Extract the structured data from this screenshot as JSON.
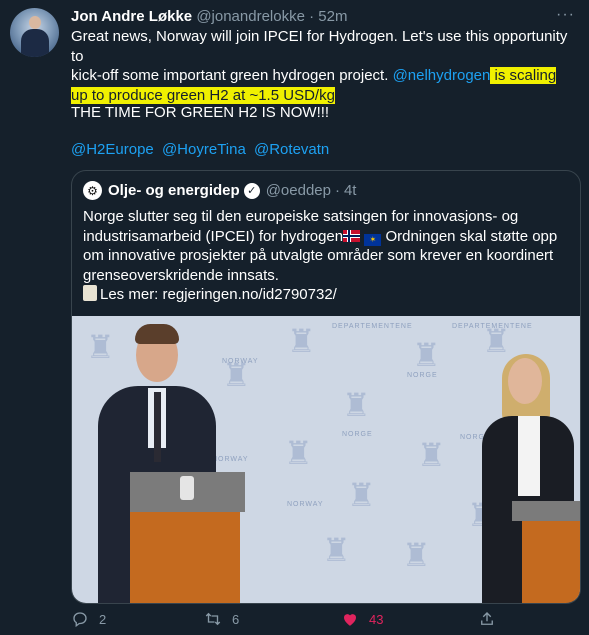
{
  "tweet": {
    "author_name": "Jon Andre Løkke",
    "author_handle": "@jonandrelokke",
    "separator": "·",
    "time": "52m",
    "more_label": "···",
    "line1": "Great news, Norway will join IPCEI for Hydrogen. Let's use this opportunity to",
    "line2_prefix": "kick-off some important green hydrogen project. ",
    "line2_mention": "@nelhydrogen",
    "line2_highlight": " is scaling",
    "line3_highlight": "up to produce green H2 at ~1.5 USD/kg",
    "shout": "THE TIME FOR GREEN H2 IS NOW!!!",
    "hashtags": [
      "@H2Europe",
      "@HoyreTina",
      "@Rotevatn"
    ]
  },
  "quote": {
    "author_name": "Olje- og energidep",
    "author_handle": "@oeddep",
    "separator": "·",
    "time": "4t",
    "verified_icon": "✓",
    "text_line1": "Norge slutter seg til den europeiske satsingen for innovasjons- og",
    "text_line2_a": "industrisamarbeid (IPCEI) for hydrogen",
    "text_line2_b": " Ordningen skal støtte opp",
    "text_line3": "om innovative prosjekter på utvalgte områder som krever en koordinert",
    "text_line4": "grenseoverskridende innsats.",
    "text_line5": "Les mer: regjeringen.no/id2790732/",
    "eu_stars": "✶"
  },
  "photo": {
    "backdrop_texts": [
      "NORWAY",
      "NORGE",
      "NORWAY",
      "NORGE",
      "NORGE",
      "NORWAY",
      "DEPARTEMENTENE",
      "DEPARTEMENTENE"
    ]
  },
  "actions": {
    "reply_count": "2",
    "retweet_count": "6",
    "like_count": "43"
  },
  "colors": {
    "background": "#15202b",
    "link": "#1da1f2",
    "highlight": "#f0f000",
    "muted": "#8899a6",
    "like": "#e0245e"
  }
}
